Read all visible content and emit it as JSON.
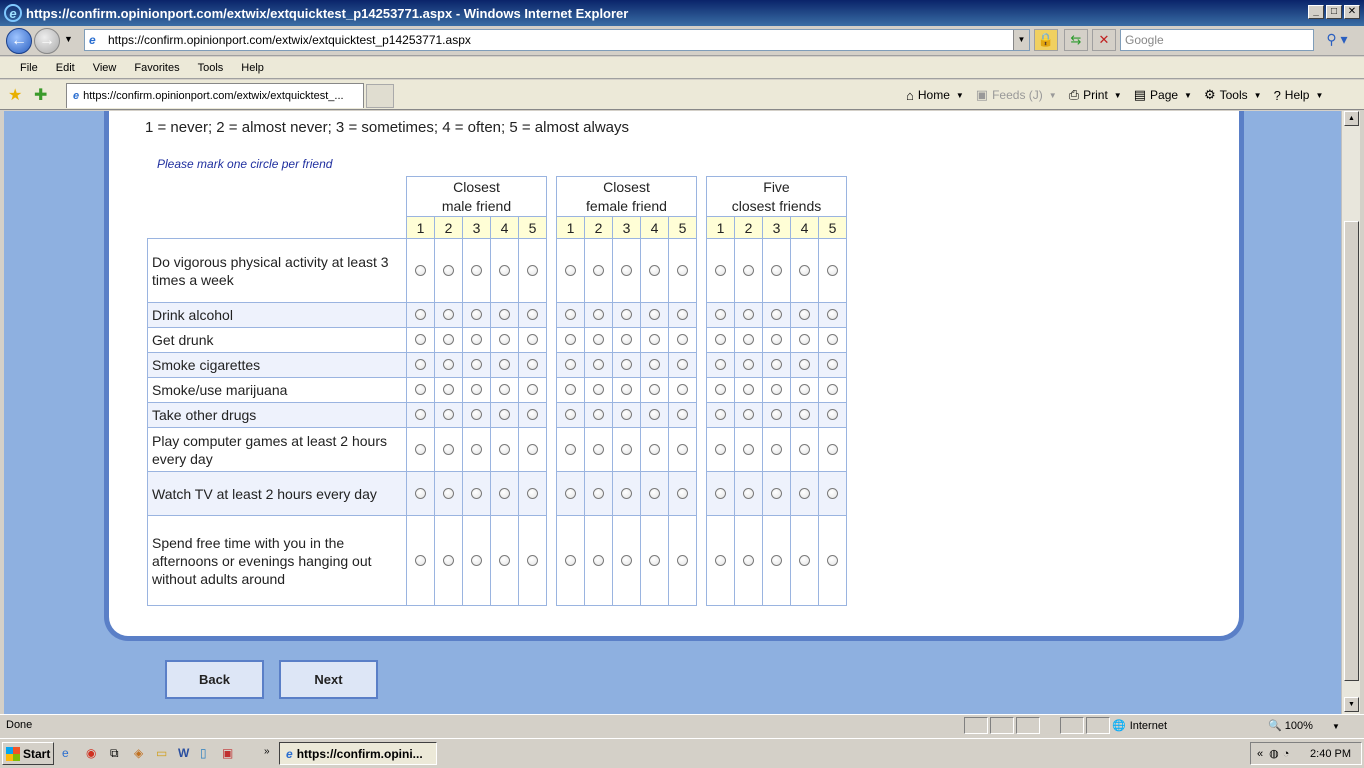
{
  "window": {
    "title": "https://confirm.opinionport.com/extwix/extquicktest_p14253771.aspx - Windows Internet Explorer",
    "minimize": "_",
    "maximize": "□",
    "close": "✕"
  },
  "address": {
    "url": "https://confirm.opinionport.com/extwix/extquicktest_p14253771.aspx",
    "search_placeholder": "Google"
  },
  "menu": [
    "File",
    "Edit",
    "View",
    "Favorites",
    "Tools",
    "Help"
  ],
  "tab": {
    "label": "https://confirm.opinionport.com/extwix/extquicktest_..."
  },
  "commands": {
    "home": "Home",
    "feeds": "Feeds (J)",
    "print": "Print",
    "page": "Page",
    "tools": "Tools",
    "help": "Help"
  },
  "survey": {
    "scale_text": "1 = never; 2 = almost never; 3 = sometimes; 4 = often; 5 = almost always",
    "instruction": "Please mark one circle per friend",
    "groups": [
      {
        "line1": "Closest",
        "line2": "male friend"
      },
      {
        "line1": "Closest",
        "line2": "female friend"
      },
      {
        "line1": "Five",
        "line2": "closest friends"
      }
    ],
    "scale_points": [
      "1",
      "2",
      "3",
      "4",
      "5"
    ],
    "questions": [
      "Do vigorous physical activity at least 3 times a week",
      "Drink alcohol",
      "Get drunk",
      "Smoke cigarettes",
      "Smoke/use marijuana",
      "Take other drugs",
      "Play computer games at least 2 hours every day",
      "Watch TV at least 2 hours every day",
      "Spend free time with you in the afternoons or evenings hanging out without adults around"
    ],
    "back_label": "Back",
    "next_label": "Next"
  },
  "status": {
    "text": "Done",
    "zone": "Internet",
    "zoom": "100%"
  },
  "taskbar": {
    "start": "Start",
    "item": "https://confirm.opini...",
    "clock": "2:40 PM"
  }
}
